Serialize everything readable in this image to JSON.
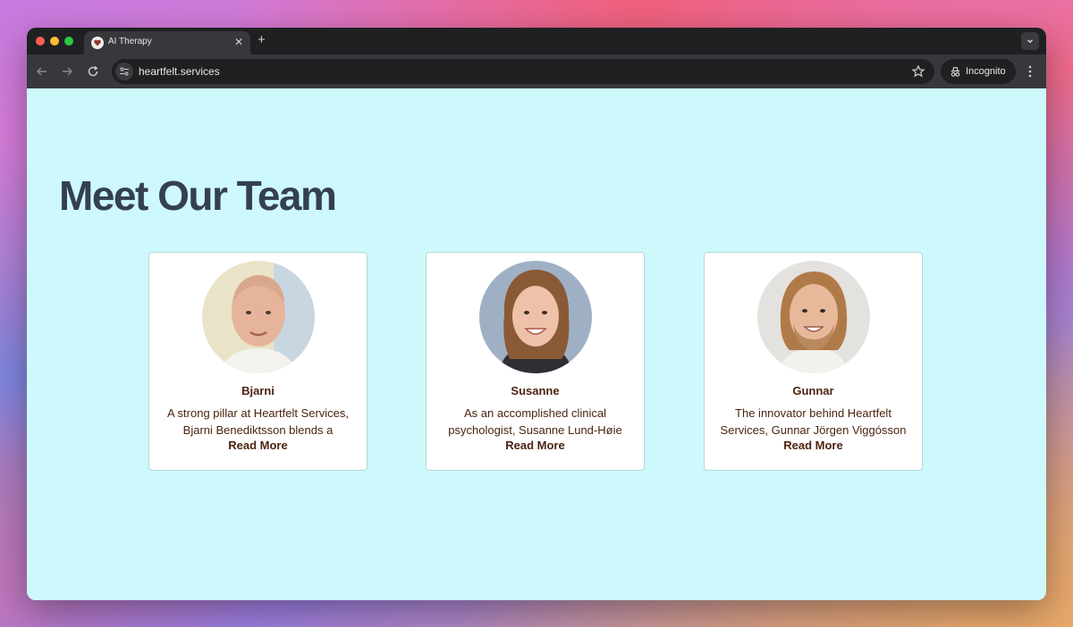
{
  "browser": {
    "tab_title": "AI Therapy",
    "tab_close": "✕",
    "new_tab": "+",
    "url": "heartfelt.services",
    "incognito_label": "Incognito",
    "icons": [
      "back-icon",
      "forward-icon",
      "reload-icon",
      "site-info-icon",
      "star-icon",
      "incognito-icon",
      "more-icon",
      "chevron-down-icon"
    ]
  },
  "page": {
    "heading": "Meet Our Team",
    "background_color": "#cdf8fc",
    "text_color": "#4b2410",
    "heading_color": "#34404f"
  },
  "team": [
    {
      "name": "Bjarni",
      "bio": "A strong pillar at Heartfelt Services, Bjarni Benediktsson blends a",
      "cta": "Read More"
    },
    {
      "name": "Susanne",
      "bio": "As an accomplished clinical psychologist, Susanne Lund-Høie",
      "cta": "Read More"
    },
    {
      "name": "Gunnar",
      "bio": "The innovator behind Heartfelt Services, Gunnar Jörgen Viggósson",
      "cta": "Read More"
    }
  ]
}
